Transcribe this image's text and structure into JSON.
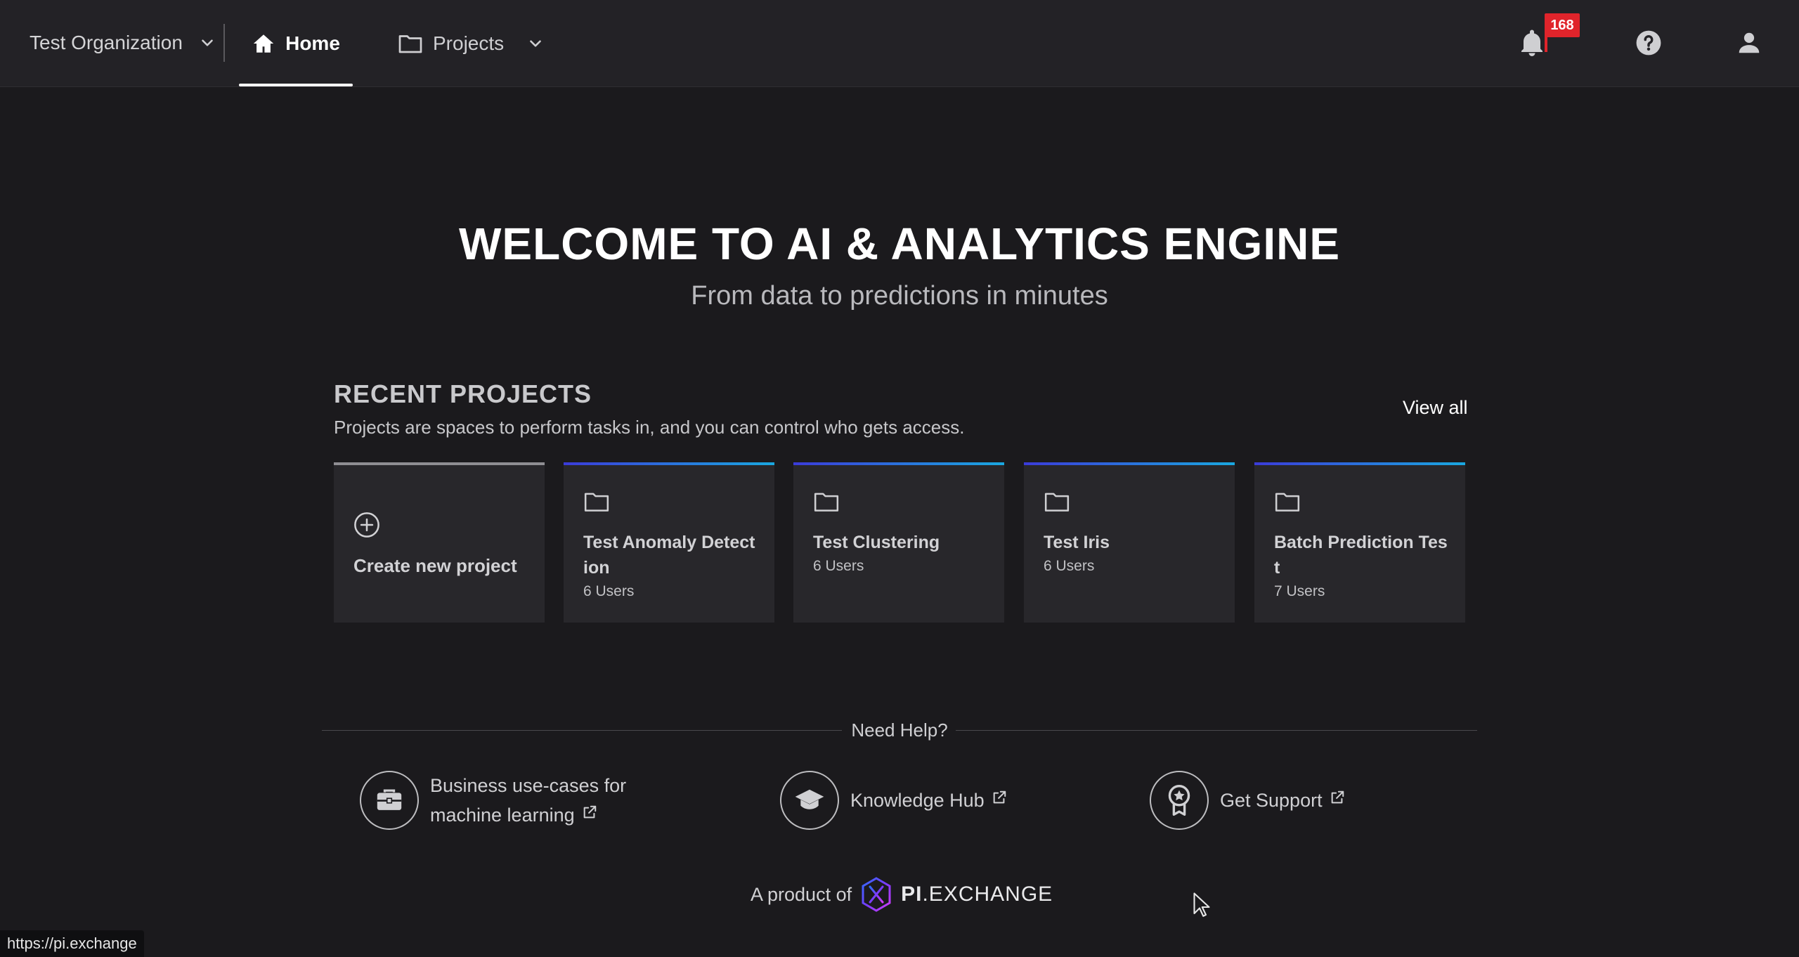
{
  "header": {
    "org_name": "Test Organization",
    "tab_home": "Home",
    "tab_projects": "Projects",
    "notification_count": "168"
  },
  "hero": {
    "title": "WELCOME TO AI & ANALYTICS ENGINE",
    "subtitle": "From data to predictions in minutes"
  },
  "recent_projects": {
    "title": "RECENT PROJECTS",
    "description": "Projects are spaces to perform tasks in, and you can control who gets access.",
    "view_all": "View all",
    "create_label": "Create new project",
    "projects": [
      {
        "name": "Test Anomaly Detection",
        "users": "6 Users"
      },
      {
        "name": "Test Clustering",
        "users": "6 Users"
      },
      {
        "name": "Test Iris",
        "users": "6 Users"
      },
      {
        "name": "Batch Prediction Test",
        "users": "7 Users"
      }
    ]
  },
  "help": {
    "title": "Need Help?",
    "items": [
      {
        "line1": "Business use-cases for",
        "line2": "machine learning",
        "icon": "briefcase-icon"
      },
      {
        "label": "Knowledge Hub",
        "icon": "graduation-cap-icon"
      },
      {
        "label": "Get Support",
        "icon": "award-icon"
      }
    ]
  },
  "footer": {
    "prefix": "A product of",
    "brand_bold": "PI",
    "brand_rest": ".EXCHANGE"
  },
  "status_url": "https://pi.exchange",
  "colors": {
    "background": "#1b1a1d",
    "topbar": "#232226",
    "card": "#28272b",
    "badge": "#e0242b",
    "accent_start": "#3b3bd9",
    "accent_end": "#1aa8e0"
  }
}
